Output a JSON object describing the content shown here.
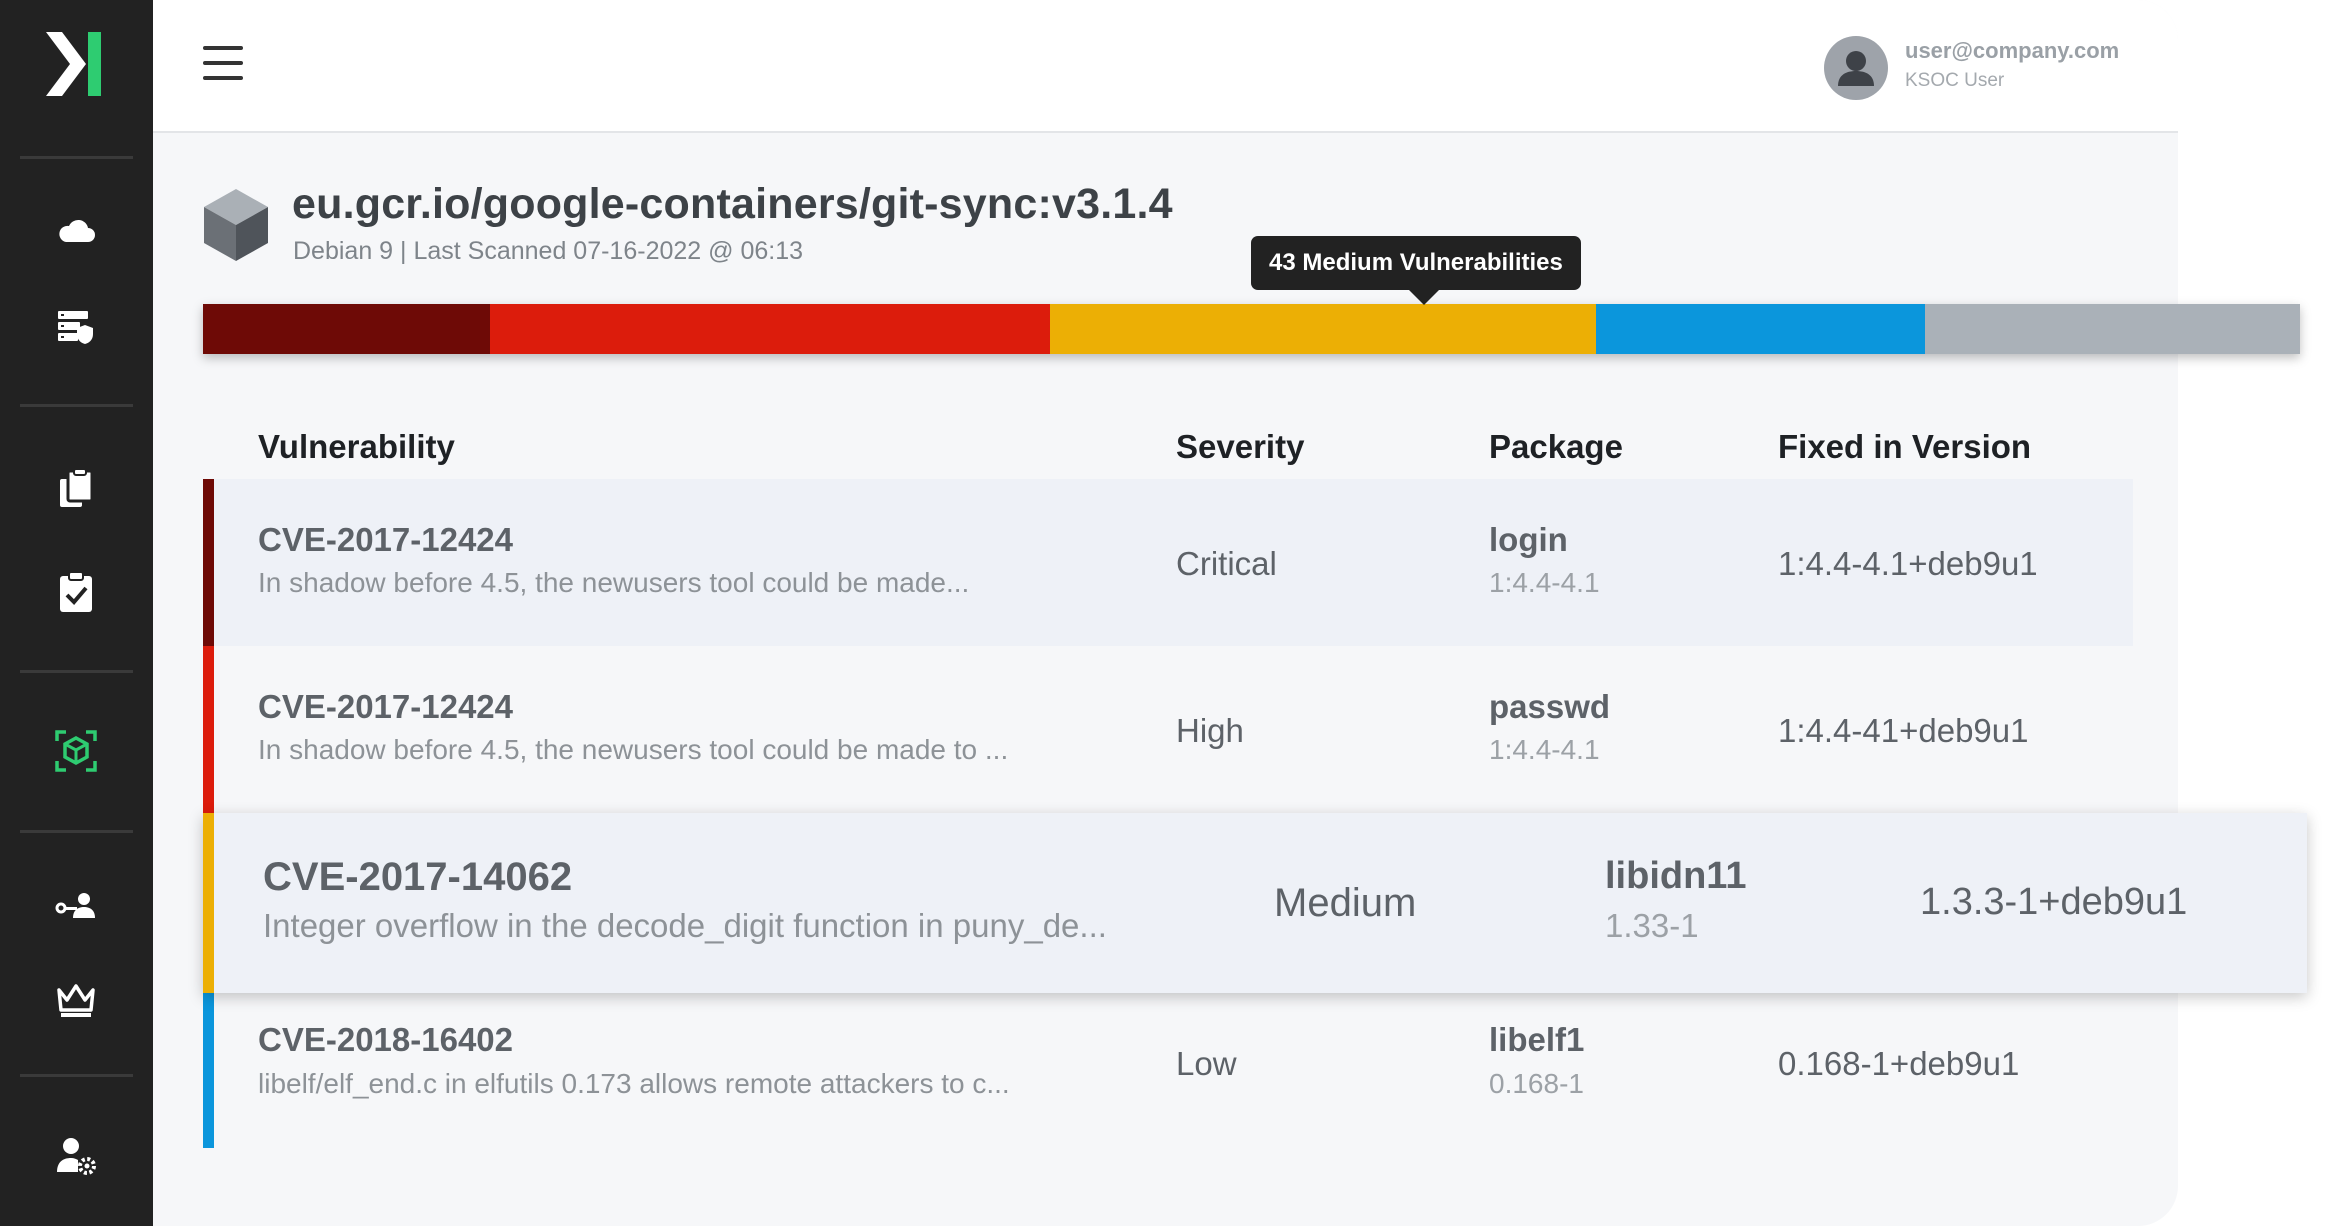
{
  "sidebar": {
    "nav": [
      "cloud-icon",
      "server-shield-icon",
      "clipboard-copy-icon",
      "clipboard-check-icon",
      "container-scan-icon",
      "key-user-icon",
      "crown-icon",
      "user-settings-icon"
    ],
    "active": "container-scan-icon",
    "accent": "#2ecc71"
  },
  "header": {
    "user_email": "user@company.com",
    "user_role": "KSOC User"
  },
  "image": {
    "title": "eu.gcr.io/google-containers/git-sync:v3.1.4",
    "subtitle": "Debian 9 | Last Scanned 07-16-2022 @ 06:13"
  },
  "severity_bar": {
    "tooltip": "43 Medium Vulnerabilities",
    "segments": [
      {
        "name": "critical",
        "color": "#6e0a06"
      },
      {
        "name": "high",
        "color": "#dc1c0c"
      },
      {
        "name": "medium",
        "color": "#ecaf05"
      },
      {
        "name": "low",
        "color": "#0b96dc"
      },
      {
        "name": "unknown",
        "color": "#aab1b8"
      }
    ]
  },
  "table": {
    "headers": [
      "Vulnerability",
      "Severity",
      "Package",
      "Fixed in Version"
    ],
    "rows": [
      {
        "cve": "CVE-2017-12424",
        "desc": "In shadow before 4.5, the newusers tool could be made...",
        "severity": "Critical",
        "package": "login",
        "package_version": "1:4.4-4.1",
        "fixed": "1:4.4-4.1+deb9u1",
        "color": "#6e0a06"
      },
      {
        "cve": "CVE-2017-12424",
        "desc": "In shadow before 4.5, the newusers tool could be made to ...",
        "severity": "High",
        "package": "passwd",
        "package_version": "1:4.4-4.1",
        "fixed": "1:4.4-41+deb9u1",
        "color": "#dc1c0c"
      },
      {
        "cve": "CVE-2017-14062",
        "desc": "Integer overflow in the decode_digit function in puny_de...",
        "severity": "Medium",
        "package": "libidn11",
        "package_version": "1.33-1",
        "fixed": "1.3.3-1+deb9u1",
        "color": "#ecaf05"
      },
      {
        "cve": "CVE-2018-16402",
        "desc": "libelf/elf_end.c in elfutils 0.173 allows remote attackers to c...",
        "severity": "Low",
        "package": "libelf1",
        "package_version": "0.168-1",
        "fixed": "0.168-1+deb9u1",
        "color": "#0b96dc"
      }
    ]
  }
}
